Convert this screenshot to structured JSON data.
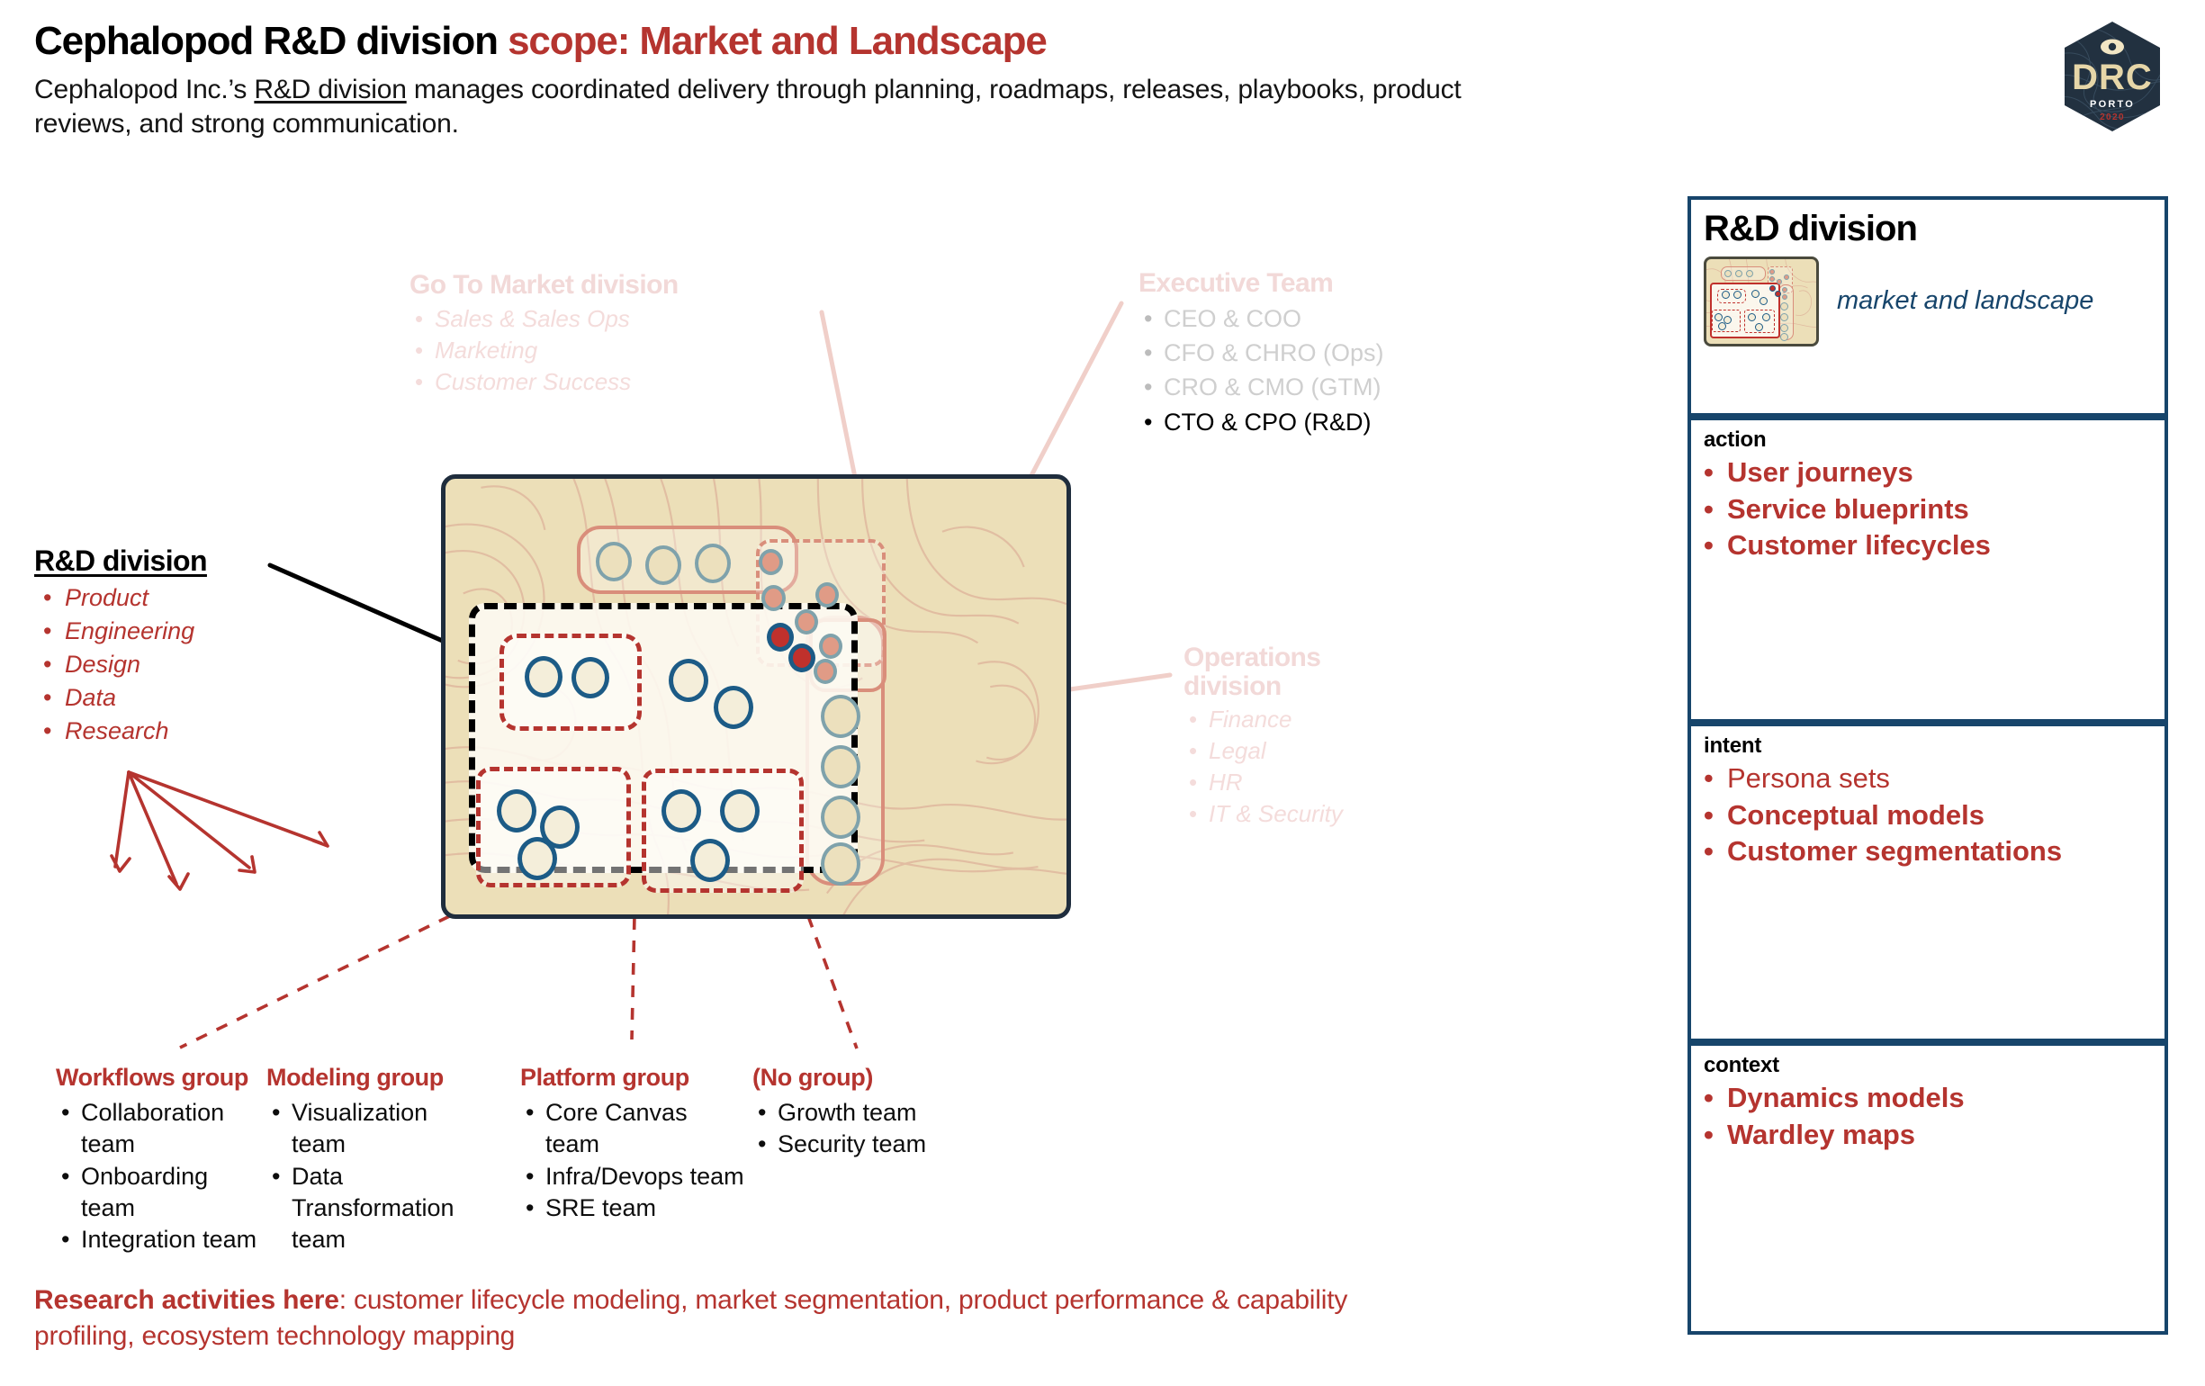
{
  "header": {
    "title_black": "Cephalopod R&D division",
    "title_red": "scope: Market and Landscape",
    "subtitle_pre": "Cephalopod Inc.’s ",
    "subtitle_underline": "R&D division",
    "subtitle_post": " manages coordinated delivery through planning, roadmaps, releases, playbooks, product reviews, and strong communication."
  },
  "logo": {
    "word": "DRC",
    "place": "PORTO",
    "year": "2020"
  },
  "labels": {
    "gtm": {
      "title": "Go To Market division",
      "items": [
        "Sales & Sales Ops",
        "Marketing",
        "Customer Success"
      ]
    },
    "exec": {
      "title": "Executive Team",
      "items": [
        "CEO & COO",
        "CFO & CHRO (Ops)",
        "CRO & CMO (GTM)",
        "CTO & CPO (R&D)"
      ],
      "highlight_index": 3
    },
    "ops": {
      "title": "Operations division",
      "items": [
        "Finance",
        "Legal",
        "HR",
        "IT & Security"
      ]
    },
    "rnd": {
      "title": "R&D division",
      "items": [
        "Product",
        "Engineering",
        "Design",
        "Data",
        "Research"
      ]
    }
  },
  "groups": [
    {
      "title": "Workflows group",
      "items": [
        "Collaboration team",
        "Onboarding team",
        "Integration team"
      ]
    },
    {
      "title": "Modeling group",
      "items": [
        "Visualization team",
        "Data Transformation team"
      ]
    },
    {
      "title": "Platform group",
      "items": [
        "Core Canvas team",
        "Infra/Devops team",
        "SRE team"
      ]
    },
    {
      "title": "(No group)",
      "items": [
        "Growth team",
        "Security team"
      ]
    }
  ],
  "footer": {
    "bold": "Research activities here",
    "rest": ": customer lifecycle modeling, market segmentation, product performance & capability profiling, ecosystem technology mapping"
  },
  "panel": {
    "title": "R&D division",
    "subtitle": "market and landscape",
    "sections": [
      {
        "heading": "action",
        "items": [
          {
            "text": "User journeys",
            "emphasis": "bold"
          },
          {
            "text": "Service blueprints",
            "emphasis": "bold"
          },
          {
            "text": "Customer lifecycles",
            "emphasis": "bold"
          }
        ]
      },
      {
        "heading": "intent",
        "items": [
          {
            "text": "Persona sets",
            "emphasis": "light"
          },
          {
            "text": "Conceptual models",
            "emphasis": "bold"
          },
          {
            "text": "Customer segmentations",
            "emphasis": "bold"
          }
        ]
      },
      {
        "heading": "context",
        "items": [
          {
            "text": "Dynamics models",
            "emphasis": "bold"
          },
          {
            "text": "Wardley maps",
            "emphasis": "bold"
          }
        ]
      }
    ]
  },
  "colors": {
    "accent_red": "#b5342f",
    "panel_blue": "#17456b",
    "map_tan": "#ecdfb8",
    "salmon": "#d98e7b",
    "faded_pink": "#f2d9d8",
    "node_blue": "#1c5b86",
    "node_teal": "#7fa2ab",
    "frame_dark": "#1f2d3d"
  },
  "map": {
    "zones": [
      {
        "name": "go-to-market-zone",
        "style": "solid-salmon"
      },
      {
        "name": "executive-zone",
        "style": "dashed-salmon"
      },
      {
        "name": "operations-zone",
        "style": "solid-salmon"
      },
      {
        "name": "rnd-zone",
        "style": "dashed-black"
      },
      {
        "name": "modeling-group-zone",
        "style": "dashed-red"
      },
      {
        "name": "workflows-group-zone",
        "style": "dashed-red"
      },
      {
        "name": "platform-group-zone",
        "style": "dashed-red"
      }
    ],
    "node_counts": {
      "gtm_teal": 3,
      "exec_salmon": 6,
      "ops_teal": 4,
      "rnd_blue": 11,
      "rnd_red": 2
    }
  }
}
